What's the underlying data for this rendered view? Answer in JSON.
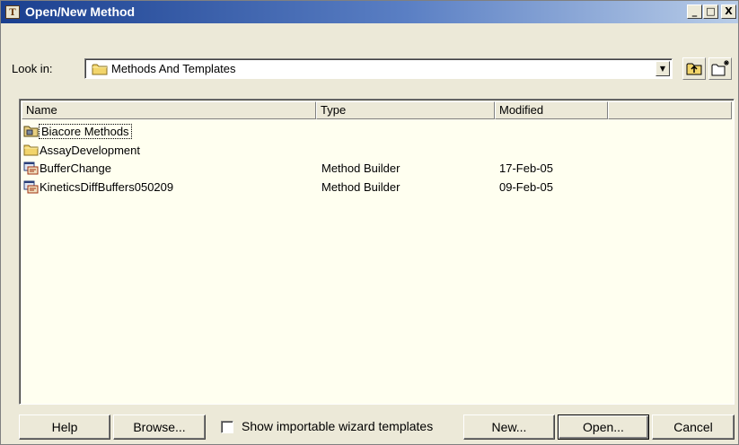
{
  "window": {
    "title": "Open/New Method",
    "app_icon_text": "T₁₀₀",
    "controls": {
      "minimize": "_",
      "maximize": "□",
      "close": "X"
    }
  },
  "lookin": {
    "label": "Look in:",
    "value": "Methods And Templates",
    "dropdown_arrow": "▼"
  },
  "toolbar": {
    "up_icon": "up-folder-icon",
    "new_folder_icon": "new-folder-icon"
  },
  "list": {
    "columns": [
      "Name",
      "Type",
      "Modified",
      ""
    ],
    "rows": [
      {
        "name": "Biacore Methods",
        "type": "",
        "modified": "",
        "icon": "special-folder-icon"
      },
      {
        "name": "AssayDevelopment",
        "type": "",
        "modified": "",
        "icon": "folder-icon"
      },
      {
        "name": "BufferChange",
        "type": "Method Builder",
        "modified": "17-Feb-05",
        "icon": "method-file-icon"
      },
      {
        "name": "KineticsDiffBuffers050209",
        "type": "Method Builder",
        "modified": "09-Feb-05",
        "icon": "method-file-icon"
      }
    ]
  },
  "footer": {
    "help": "Help",
    "browse": "Browse...",
    "checkbox_label": "Show importable wizard templates",
    "checkbox_checked": false,
    "new": "New...",
    "open": "Open...",
    "cancel": "Cancel"
  },
  "colors": {
    "titlebar_start": "#1a3f8f",
    "titlebar_end": "#b9cde8",
    "list_background": "#fffff0",
    "dialog_face": "#ece9d8",
    "folder": "#f2d56b"
  }
}
